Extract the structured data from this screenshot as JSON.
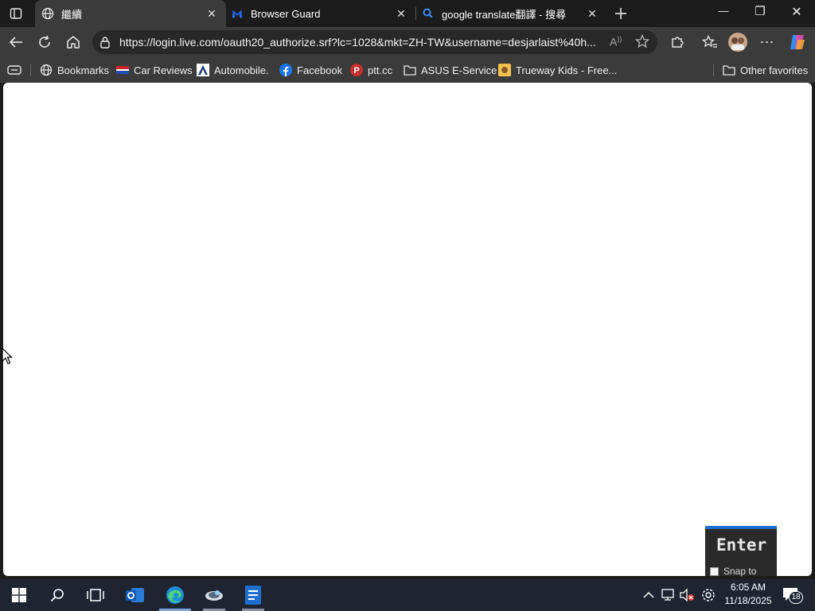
{
  "tabs": [
    {
      "label": "繼續",
      "close": "✕"
    },
    {
      "label": "Browser Guard",
      "close": "✕"
    },
    {
      "label": "google translate翻譯 - 搜尋",
      "close": "✕"
    }
  ],
  "window_controls": {
    "minimize": "—",
    "restore": "❐",
    "close": "✕"
  },
  "address_bar": {
    "url": "https://login.live.com/oauth20_authorize.srf?lc=1028&mkt=ZH-TW&username=desjarlaist%40h..."
  },
  "favorites": [
    {
      "label": "Bookmarks"
    },
    {
      "label": "Car Reviews"
    },
    {
      "label": "Automobile."
    },
    {
      "label": "Facebook"
    },
    {
      "label": "ptt.cc"
    },
    {
      "label": "ASUS E-Service"
    },
    {
      "label": "Trueway Kids - Free..."
    }
  ],
  "other_favorites": "Other favorites",
  "overlay": {
    "title": "Enter",
    "snap_label": "Snap to"
  },
  "taskbar": {
    "time": "6:05 AM",
    "date": "11/18/2025",
    "notification_count": "18"
  },
  "colors": {
    "accent": "#1e6fd0",
    "tab_active": "#3b3b3b",
    "taskbar": "#1e2430"
  }
}
